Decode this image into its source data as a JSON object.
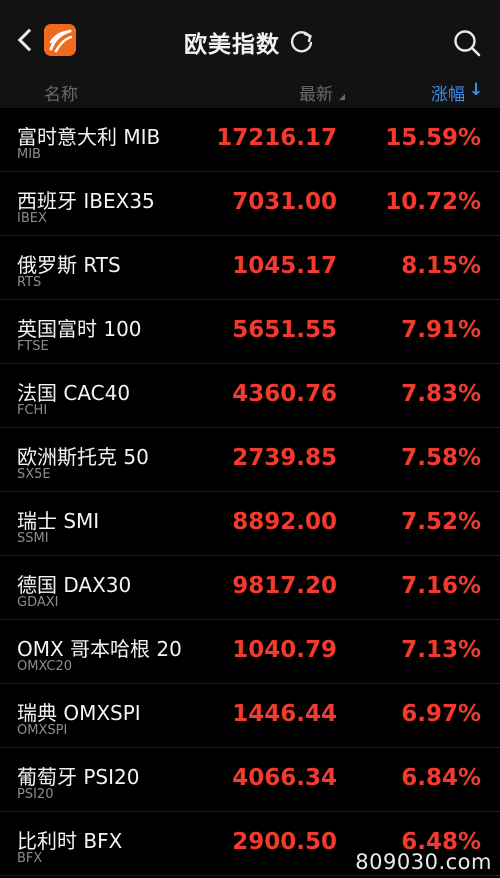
{
  "header": {
    "title": "欧美指数",
    "icons": [
      "back-icon",
      "app-logo",
      "refresh-icon",
      "search-icon"
    ]
  },
  "columns": {
    "name": "名称",
    "latest": "最新",
    "change": "涨幅",
    "sort_arrow": "↓"
  },
  "colors": {
    "up": "#f23a2f",
    "accent": "#3e8ee8",
    "logo": "#f06a1d"
  },
  "rows": [
    {
      "name": "富时意大利 MIB",
      "code": "MIB",
      "price": "17216.17",
      "change": "15.59%"
    },
    {
      "name": "西班牙 IBEX35",
      "code": "IBEX",
      "price": "7031.00",
      "change": "10.72%"
    },
    {
      "name": "俄罗斯 RTS",
      "code": "RTS",
      "price": "1045.17",
      "change": "8.15%"
    },
    {
      "name": "英国富时 100",
      "code": "FTSE",
      "price": "5651.55",
      "change": "7.91%"
    },
    {
      "name": "法国 CAC40",
      "code": "FCHI",
      "price": "4360.76",
      "change": "7.83%"
    },
    {
      "name": "欧洲斯托克 50",
      "code": "SX5E",
      "price": "2739.85",
      "change": "7.58%"
    },
    {
      "name": "瑞士 SMI",
      "code": "SSMI",
      "price": "8892.00",
      "change": "7.52%"
    },
    {
      "name": "德国 DAX30",
      "code": "GDAXI",
      "price": "9817.20",
      "change": "7.16%"
    },
    {
      "name": "OMX 哥本哈根 20",
      "code": "OMXC20",
      "price": "1040.79",
      "change": "7.13%"
    },
    {
      "name": "瑞典 OMXSPI",
      "code": "OMXSPI",
      "price": "1446.44",
      "change": "6.97%"
    },
    {
      "name": "葡萄牙 PSI20",
      "code": "PSI20",
      "price": "4066.34",
      "change": "6.84%"
    },
    {
      "name": "比利时 BFX",
      "code": "BFX",
      "price": "2900.50",
      "change": "6.48%"
    }
  ],
  "watermark": "809030.com"
}
